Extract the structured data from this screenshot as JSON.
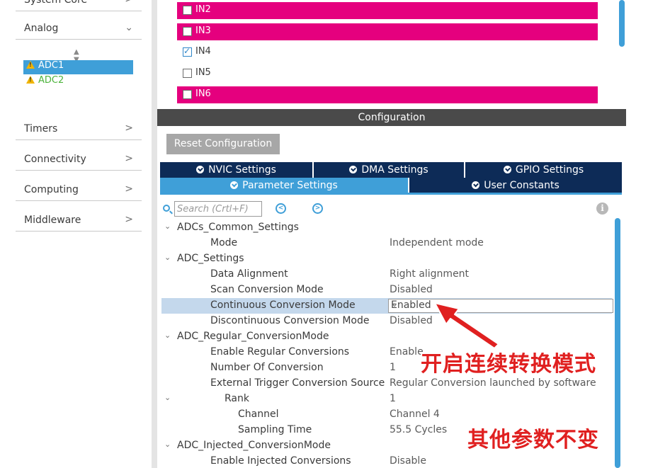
{
  "sidebar": {
    "top_partial": {
      "label": "System Core"
    },
    "categories": [
      {
        "label": "Analog",
        "chevron": "chevron-down-icon"
      },
      {
        "label": "Timers",
        "chevron": "chevron-right-icon"
      },
      {
        "label": "Connectivity",
        "chevron": "chevron-right-icon"
      },
      {
        "label": "Computing",
        "chevron": "chevron-right-icon"
      },
      {
        "label": "Middleware",
        "chevron": "chevron-right-icon"
      }
    ],
    "analog_items": [
      {
        "label": "ADC1",
        "status": "warning-icon",
        "selected": true
      },
      {
        "label": "ADC2",
        "status": "warning-icon",
        "selected": false
      }
    ]
  },
  "mode": {
    "channels": [
      {
        "label": "IN2",
        "checked": false,
        "highlight": true
      },
      {
        "label": "IN3",
        "checked": false,
        "highlight": true
      },
      {
        "label": "IN4",
        "checked": true,
        "highlight": false
      },
      {
        "label": "IN5",
        "checked": false,
        "highlight": false
      },
      {
        "label": "IN6",
        "checked": false,
        "highlight": true
      }
    ]
  },
  "configuration": {
    "header": "Configuration",
    "reset_label": "Reset Configuration",
    "tabs_row1": [
      {
        "label": "NVIC Settings"
      },
      {
        "label": "DMA Settings"
      },
      {
        "label": "GPIO Settings"
      }
    ],
    "tabs_row2": [
      {
        "label": "Parameter Settings",
        "active": true
      },
      {
        "label": "User Constants",
        "active": false
      }
    ],
    "search_placeholder": "Search (Crtl+F)",
    "info_icon": "i",
    "params": [
      {
        "name": "ADCs_Common_Settings",
        "value": ""
      },
      {
        "name": "Mode",
        "value": "Independent mode"
      },
      {
        "name": "ADC_Settings",
        "value": ""
      },
      {
        "name": "Data Alignment",
        "value": "Right alignment"
      },
      {
        "name": "Scan Conversion Mode",
        "value": "Disabled"
      },
      {
        "name": "Continuous Conversion Mode",
        "value": "Enabled"
      },
      {
        "name": "Discontinuous Conversion Mode",
        "value": "Disabled"
      },
      {
        "name": "ADC_Regular_ConversionMode",
        "value": ""
      },
      {
        "name": "Enable Regular Conversions",
        "value": "Enable"
      },
      {
        "name": "Number Of Conversion",
        "value": "1"
      },
      {
        "name": "External Trigger Conversion Source",
        "value": "Regular Conversion launched by software"
      },
      {
        "name": "Rank",
        "value": "1"
      },
      {
        "name": "Channel",
        "value": "Channel 4"
      },
      {
        "name": "Sampling Time",
        "value": "55.5 Cycles"
      },
      {
        "name": "ADC_Injected_ConversionMode",
        "value": ""
      },
      {
        "name": "Enable Injected Conversions",
        "value": "Disable"
      }
    ]
  },
  "annotations": {
    "continuous_note": "开启连续转换模式",
    "others_note": "其他参数不变"
  },
  "colors": {
    "accent_blue": "#3f9fd8",
    "navy_tab": "#0d2b57",
    "pin_highlight": "#e5007e",
    "annotation_red": "#e02020"
  }
}
